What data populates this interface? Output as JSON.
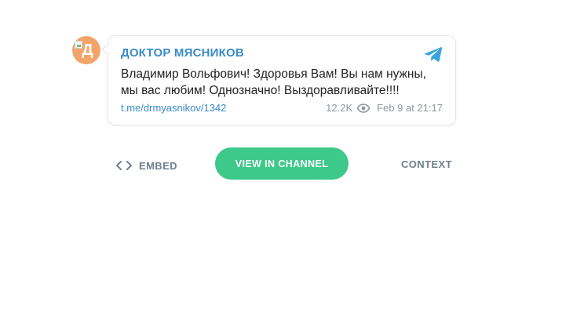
{
  "channel": {
    "avatar_letter": "Д",
    "name": "ДОКТОР МЯСНИКОВ"
  },
  "post": {
    "text": "Владимир Вольфович! Здоровья Вам! Вы нам нужны, мы вас любим! Однозначно! Выздоравливайте!!!!",
    "link": "t.me/drmyasnikov/1342",
    "views": "12.2K",
    "date": "Feb 9 at 21:17"
  },
  "actions": {
    "embed_label": "EMBED",
    "view_label": "VIEW IN CHANNEL",
    "context_label": "CONTEXT"
  },
  "icons": {
    "logo": "telegram-icon",
    "views": "eye-icon",
    "embed": "code-icon"
  },
  "colors": {
    "accent": "#3a8bc8",
    "button": "#3dc98a",
    "avatar": "#f2a46a",
    "muted": "#8c97a1"
  }
}
